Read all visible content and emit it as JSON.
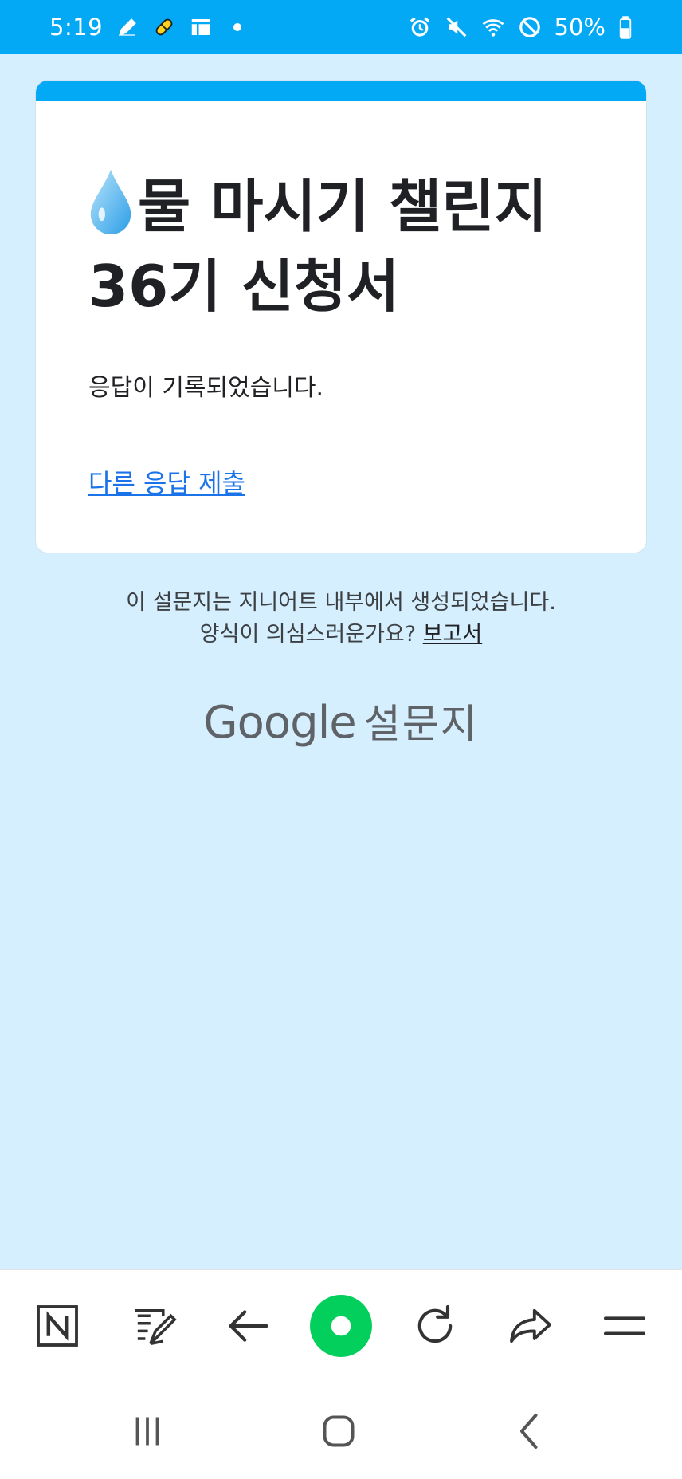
{
  "status_bar": {
    "time": "5:19",
    "battery": "50%",
    "left_icons": [
      "pen-icon",
      "pill-icon",
      "grid-icon"
    ],
    "right_icons": [
      "alarm-icon",
      "mute-icon",
      "wifi-icon",
      "do-not-disturb-icon",
      "battery-icon"
    ]
  },
  "card": {
    "title": "물 마시기 챌린지 36기 신청서",
    "message": "응답이 기록되었습니다.",
    "link": "다른 응답 제출"
  },
  "footer": {
    "line1": "이 설문지는 지니어트 내부에서 생성되었습니다.",
    "line2": "양식이 의심스러운가요?",
    "report": "보고서"
  },
  "logo": {
    "google": "Google",
    "forms": "설문지"
  },
  "browser_toolbar": {
    "buttons": [
      "naver-icon",
      "edit-icon",
      "back-arrow-icon",
      "home-circle-icon",
      "refresh-icon",
      "share-icon",
      "menu-icon"
    ]
  },
  "colors": {
    "accent": "#03a9f4",
    "background": "#d5efff",
    "link": "#1a73e8",
    "green": "#03cf5d"
  }
}
